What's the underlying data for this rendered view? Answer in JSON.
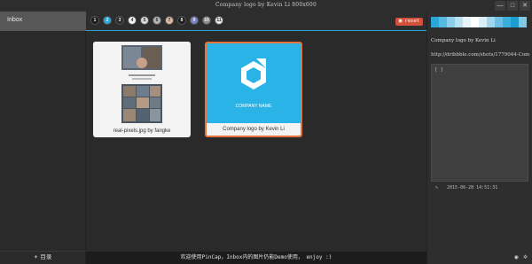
{
  "window": {
    "title": "Company logo by Kevin Li 800x600",
    "buttons": [
      "—",
      "□",
      "✕"
    ]
  },
  "sidebar": {
    "items": [
      {
        "label": "Inbox"
      }
    ],
    "add_label": "目录"
  },
  "toolbar": {
    "swatches": [
      {
        "color": "#1b1b1b",
        "label": "1"
      },
      {
        "color": "#2aa7d8",
        "label": "2"
      },
      {
        "color": "#2b2b2b",
        "label": "3"
      },
      {
        "color": "#f1f1f1",
        "label": "4"
      },
      {
        "color": "#d6d6d6",
        "label": "5"
      },
      {
        "color": "#b0b6b8",
        "label": "6"
      },
      {
        "color": "#d9b8a3",
        "label": "7"
      },
      {
        "color": "#1e1e1e",
        "label": "8"
      },
      {
        "color": "#7a7fc0",
        "label": "9"
      },
      {
        "color": "#8a8a8a",
        "label": "10"
      },
      {
        "color": "#e6e6e6",
        "label": "11"
      }
    ],
    "reset_label": "reset"
  },
  "images": [
    {
      "caption": "real-pixels.jpg by fangke",
      "selected": false
    },
    {
      "caption": "Company logo by Kevin Li",
      "selected": true,
      "logo_text": "COMPANY NAME"
    }
  ],
  "footer": {
    "message": "欢迎使用PinCap，Inbox内的图片仍能Demo使用， enjoy :)"
  },
  "details": {
    "palette": [
      "#2aa7d8",
      "#57b9e0",
      "#8ccfea",
      "#b9e1f2",
      "#e6f4fa",
      "#ffffff",
      "#d9eef8",
      "#a3d6ec",
      "#6cc0e4",
      "#3aafdc",
      "#1d9ccf",
      "#7fc8e6"
    ],
    "title": "Company logo by Kevin Li",
    "url": "http://dribbble.com/shots/1779044-Com",
    "notes": "[ ]",
    "timestamp": "2015-06-28 14:51:31",
    "pin_icon": "pin-icon",
    "share_icon": "share-icon",
    "settings_icon": "gear-icon"
  }
}
